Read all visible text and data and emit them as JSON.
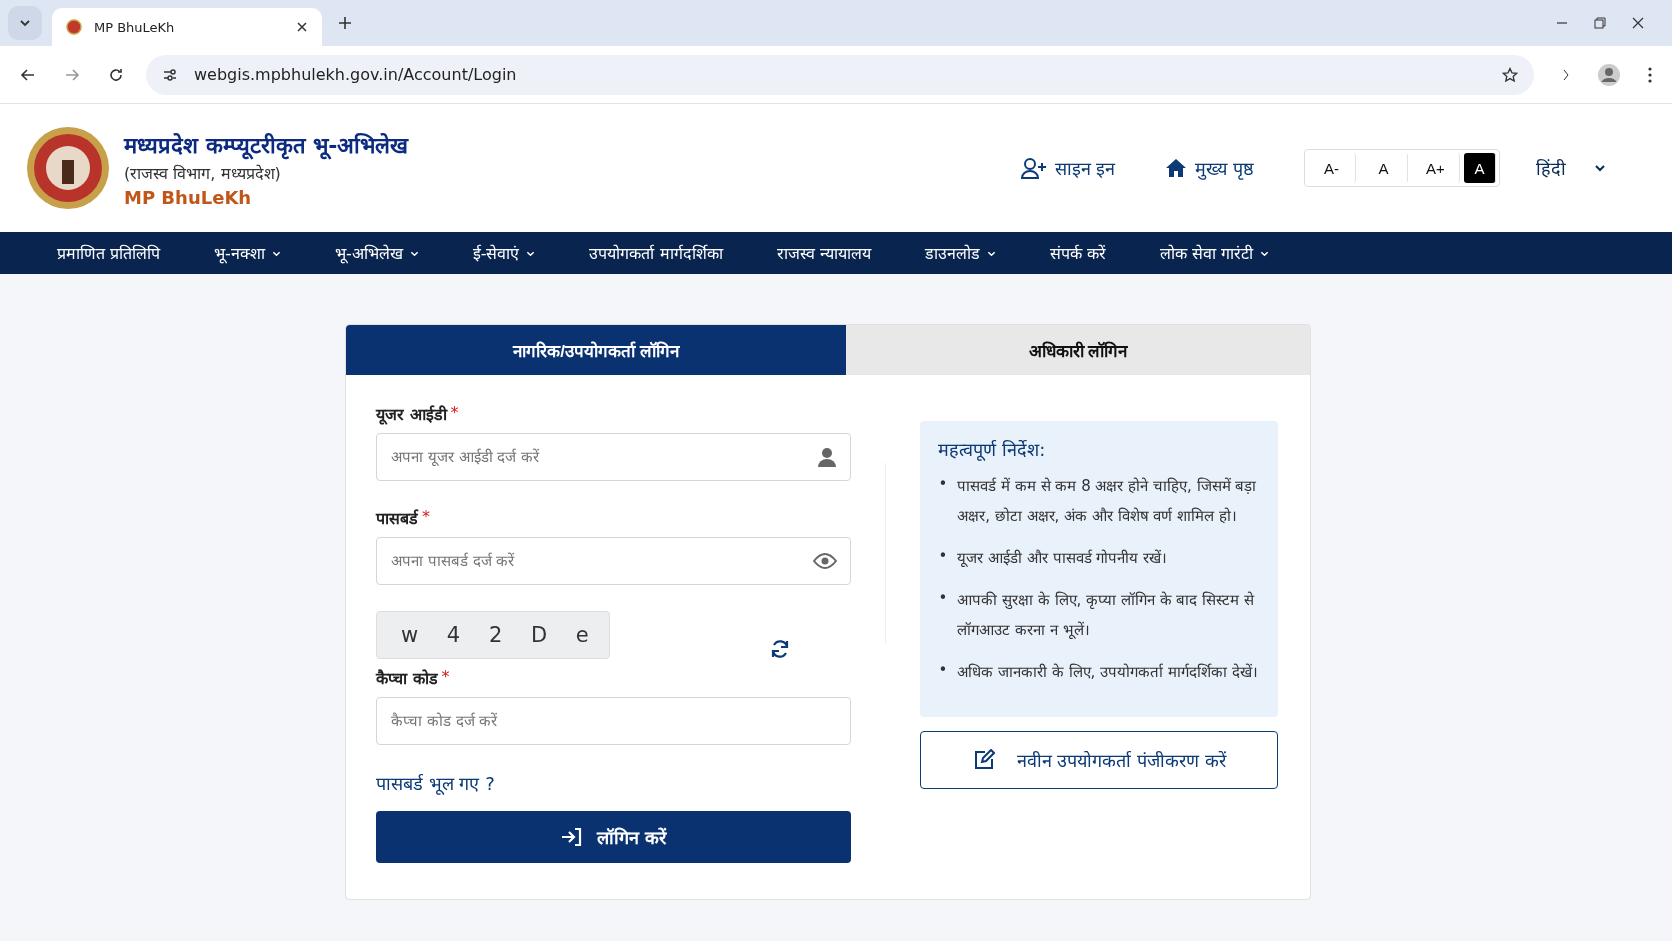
{
  "browser": {
    "tab_title": "MP BhuLeKh",
    "url": "webgis.mpbhulekh.gov.in/Account/Login"
  },
  "header": {
    "title": "मध्यप्रदेश कम्प्यूटरीकृत भू-अभिलेख",
    "subtitle": "(राजस्व विभाग, मध्यप्रदेश)",
    "brand": "MP BhuLeKh",
    "sign_in": "साइन इन",
    "home": "मुख्य पृष्ठ",
    "font_sizes": [
      {
        "label": "A-",
        "selected": false
      },
      {
        "label": "A",
        "selected": false
      },
      {
        "label": "A+",
        "selected": false
      },
      {
        "label": "A",
        "selected": true
      }
    ],
    "language": "हिंदी"
  },
  "nav": [
    {
      "label": "प्रमाणित प्रतिलिपि",
      "dropdown": false
    },
    {
      "label": "भू-नक्शा",
      "dropdown": true
    },
    {
      "label": "भू-अभिलेख",
      "dropdown": true
    },
    {
      "label": "ई-सेवाएं",
      "dropdown": true
    },
    {
      "label": "उपयोगकर्ता मार्गदर्शिका",
      "dropdown": false
    },
    {
      "label": "राजस्व न्यायालय",
      "dropdown": false
    },
    {
      "label": "डाउनलोड",
      "dropdown": true
    },
    {
      "label": "संपर्क करें",
      "dropdown": false
    },
    {
      "label": "लोक सेवा गारंटी",
      "dropdown": true
    }
  ],
  "login_tabs": [
    {
      "label": "नागरिक/उपयोगकर्ता लॉगिन",
      "selected": true
    },
    {
      "label": "अधिकारी लॉगिन",
      "selected": false
    }
  ],
  "fields": [
    {
      "label": "यूजर आईडी",
      "required_mark": "*",
      "placeholder": "अपना यूजर आईडी दर्ज करें",
      "kind": "user"
    },
    {
      "label": "पासबर्ड",
      "required_mark": "*",
      "placeholder": "अपना पासबर्ड दर्ज करें",
      "kind": "password"
    }
  ],
  "captcha": {
    "text": "w 4 2 D e",
    "label": "कैप्चा कोड",
    "required_mark": "*",
    "placeholder": "कैप्चा कोड दर्ज करें"
  },
  "forgot_password": "पासबर्ड भूल गए ?",
  "login_button": "लॉगिन करें",
  "instructions": {
    "title": "महत्वपूर्ण निर्देश:",
    "items": [
      {
        "bullet": "•",
        "text": "पासवर्ड में कम से कम 8 अक्षर होने चाहिए, जिसमें बड़ा अक्षर, छोटा अक्षर, अंक और विशेष वर्ण शामिल हो।"
      },
      {
        "bullet": "•",
        "text": "यूजर आईडी और पासवर्ड गोपनीय रखें।"
      },
      {
        "bullet": "•",
        "text": "आपकी सुरक्षा के लिए, कृप्या लॉगिन के बाद सिस्टम से लॉगआउट करना न भूलें।"
      },
      {
        "bullet": "•",
        "text": "अधिक जानकारी के लिए, उपयोगकर्ता मार्गदर्शिका देखें।"
      }
    ]
  },
  "register_button": "नवीन उपयोगकर्ता पंजीकरण करें"
}
